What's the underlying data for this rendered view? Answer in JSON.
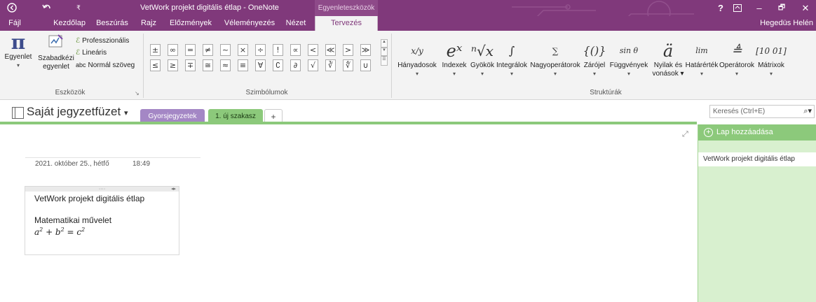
{
  "titlebar": {
    "back_icon": "back-circle-icon",
    "undo_icon": "undo-icon",
    "quick_access_icon": "customize-dropdown-icon",
    "title": "VetWork projekt digitális étlap - OneNote",
    "context_tool": "Egyenleteszközök",
    "help": "?",
    "restore_icon": "ribbon-display-icon",
    "minimize": "–",
    "maximize": "🗗",
    "close": "✕"
  },
  "tabs": {
    "items": [
      "Fájl",
      "Kezdőlap",
      "Beszúrás",
      "Rajz",
      "Előzmények",
      "Véleményezés",
      "Nézet",
      "Tervezés"
    ],
    "active": "Tervezés",
    "user": "Hegedüs Helén"
  },
  "ribbon": {
    "tools": {
      "equation_label": "Egyenlet",
      "ink_label_1": "Szabadkézi",
      "ink_label_2": "egyenlet",
      "professional": "Professzionális",
      "linear": "Lineáris",
      "normal_text": "Normál szöveg",
      "normal_text_prefix": "abc",
      "group_label": "Eszközök"
    },
    "symbols": {
      "row1": [
        "±",
        "∞",
        "=",
        "≠",
        "~",
        "×",
        "÷",
        "!",
        "∝",
        "<",
        "≪",
        ">",
        "≫"
      ],
      "row2": [
        "≤",
        "≥",
        "∓",
        "≅",
        "≈",
        "≡",
        "∀",
        "∁",
        "∂",
        "√",
        "∛",
        "∜",
        "∪"
      ],
      "group_label": "Szimbólumok"
    },
    "structures": {
      "items": [
        {
          "label": "Hányadosok",
          "icon": "x/y"
        },
        {
          "label": "Indexek",
          "icon": "eˣ"
        },
        {
          "label": "Gyökök",
          "icon": "ⁿ√x"
        },
        {
          "label": "Integrálok",
          "icon": "∫"
        },
        {
          "label": "Nagyoperátorok",
          "icon": "∑"
        },
        {
          "label": "Zárójel",
          "icon": "{()}"
        },
        {
          "label": "Függvények",
          "icon": "sin θ"
        },
        {
          "label": "Nyilak és",
          "label2": "vonások",
          "icon": "ä"
        },
        {
          "label": "Határérték",
          "icon": "lim"
        },
        {
          "label": "Operátorok",
          "icon": "≜"
        },
        {
          "label": "Mátrixok",
          "icon": "[10 01]"
        }
      ],
      "group_label": "Struktúrák"
    }
  },
  "notebook": {
    "title": "Saját jegyzetfüzet",
    "sections": [
      "Gyorsjegyzetek",
      "1. új szakasz"
    ],
    "add_section": "+",
    "search_placeholder": "Keresés (Ctrl+E)"
  },
  "page": {
    "date": "2021. október 25., hétfő",
    "time": "18:49",
    "handle_dots": "····",
    "heading": "VetWork projekt digitális étlap",
    "subheading": "Matematikai művelet",
    "equation": "a² + b² = c²"
  },
  "page_panel": {
    "add_page": "Lap hozzáadása",
    "pages": [
      "VetWork projekt digitális étlap"
    ]
  },
  "colors": {
    "accent": "#80397b",
    "section_green": "#8cc97b",
    "section_purple": "#a487c5",
    "panel_green": "#d8f0cf"
  }
}
